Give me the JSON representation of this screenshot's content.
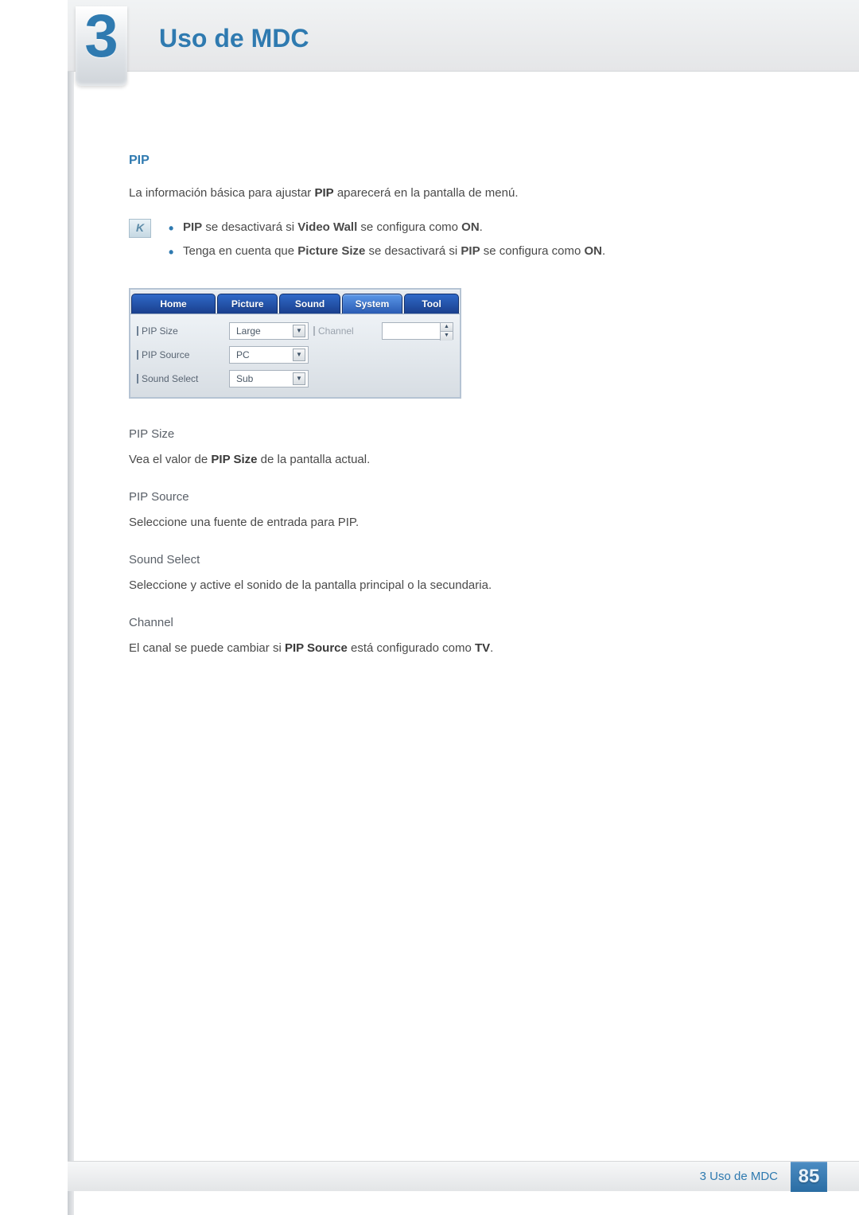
{
  "chapter": {
    "number": "3",
    "title": "Uso de MDC"
  },
  "section": {
    "heading": "PIP"
  },
  "intro_parts": {
    "p1": "La información básica para ajustar ",
    "p1_b": "PIP",
    "p1_after": " aparecerá en la pantalla de menú."
  },
  "notes": [
    {
      "b1": "PIP",
      "t1": " se desactivará si ",
      "b2": "Video Wall",
      "t2": " se configura como ",
      "b3": "ON",
      "t3": "."
    },
    {
      "t0": "Tenga en cuenta que ",
      "b1": "Picture Size",
      "t1": " se desactivará si ",
      "b2": "PIP",
      "t2": " se configura como ",
      "b3": "ON",
      "t3": "."
    }
  ],
  "ui": {
    "tabs": [
      "Home",
      "Picture",
      "Sound",
      "System",
      "Tool"
    ],
    "active_tab_index": 3,
    "rows": [
      {
        "label": "PIP Size",
        "value": "Large"
      },
      {
        "label": "PIP Source",
        "value": "PC"
      },
      {
        "label": "Sound Select",
        "value": "Sub"
      }
    ],
    "right": {
      "label": "Channel",
      "value": ""
    }
  },
  "subs": [
    {
      "h": "PIP Size",
      "p_pre": "Vea el valor de ",
      "p_b": "PIP Size",
      "p_post": " de la pantalla actual."
    },
    {
      "h": "PIP Source",
      "p_pre": "Seleccione una fuente de entrada para PIP.",
      "p_b": "",
      "p_post": ""
    },
    {
      "h": "Sound Select",
      "p_pre": "Seleccione y active el sonido de la pantalla principal o la secundaria.",
      "p_b": "",
      "p_post": ""
    },
    {
      "h": "Channel",
      "p_pre": "El canal se puede cambiar si ",
      "p_b": "PIP Source",
      "p_post": " está configurado como ",
      "p_b2": "TV",
      "p_post2": "."
    }
  ],
  "footer": {
    "label": "3 Uso de MDC",
    "page": "85"
  }
}
